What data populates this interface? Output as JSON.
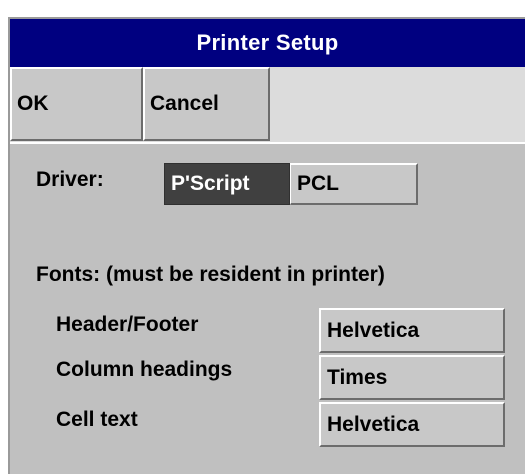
{
  "window": {
    "title": "Printer Setup"
  },
  "toolbar": {
    "ok_label": "OK",
    "cancel_label": "Cancel"
  },
  "driver": {
    "label": "Driver:",
    "options": [
      "P'Script",
      "PCL"
    ],
    "selected": "P'Script"
  },
  "fonts": {
    "heading": "Fonts: (must be resident in printer)",
    "rows": [
      {
        "label": "Header/Footer",
        "value": "Helvetica"
      },
      {
        "label": "Column headings",
        "value": "Times"
      },
      {
        "label": "Cell text",
        "value": "Helvetica"
      }
    ]
  },
  "colors": {
    "title_bar": "#000080",
    "dialog_background": "#c0c0c0",
    "selected_segment": "#404040"
  }
}
